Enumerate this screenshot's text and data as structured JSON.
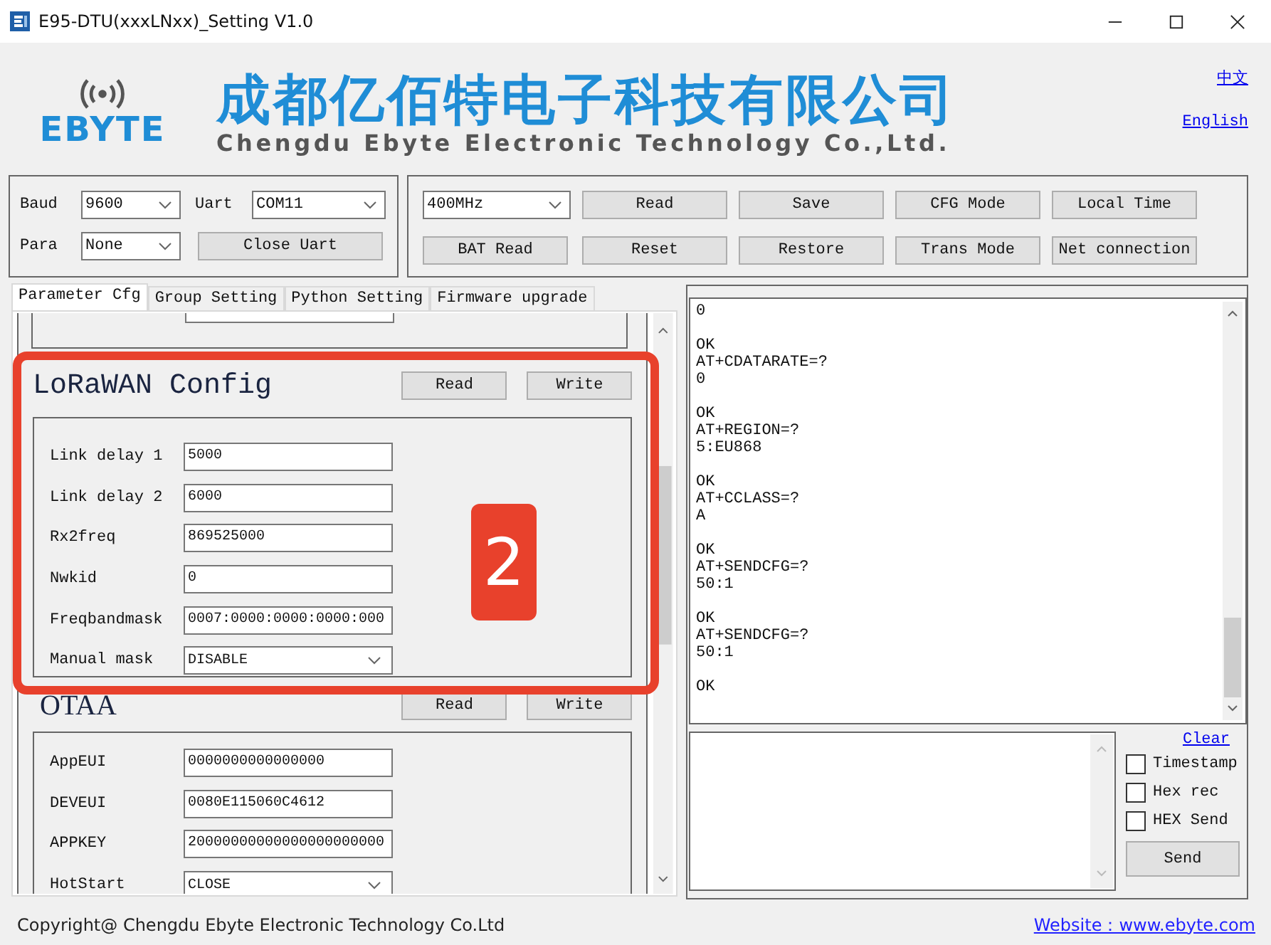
{
  "window": {
    "title": "E95-DTU(xxxLNxx)_Setting V1.0"
  },
  "header": {
    "logo_text": "EBYTE",
    "company_cn": "成都亿佰特电子科技有限公司",
    "company_en": "Chengdu Ebyte Electronic Technology Co.,Ltd.",
    "links": [
      "中文",
      "English"
    ]
  },
  "serial": {
    "fields": [
      {
        "label": "Baud",
        "value": "9600"
      },
      {
        "label": "Uart",
        "value": "COM11"
      },
      {
        "label": "Para",
        "value": "None"
      }
    ],
    "button": "Close Uart"
  },
  "device": {
    "band": "400MHz",
    "button_rows": [
      [
        "Read",
        "Save",
        "CFG Mode",
        "Local Time"
      ],
      [
        "BAT Read",
        "Reset",
        "Restore",
        "Trans Mode",
        "Net connection"
      ]
    ]
  },
  "tabs": [
    {
      "label": "Parameter Cfg",
      "selected": true
    },
    {
      "label": "Group Setting",
      "selected": false
    },
    {
      "label": "Python Setting",
      "selected": false
    },
    {
      "label": "Firmware upgrade",
      "selected": false
    }
  ],
  "sections": [
    {
      "title": "LoRaWAN Config",
      "buttons": [
        "Read",
        "Write"
      ],
      "fields": [
        {
          "kind": "input",
          "label": "Link delay 1",
          "value": "5000"
        },
        {
          "kind": "input",
          "label": "Link delay 2",
          "value": "6000"
        },
        {
          "kind": "input",
          "label": "Rx2freq",
          "value": "869525000"
        },
        {
          "kind": "input",
          "label": "Nwkid",
          "value": "0"
        },
        {
          "kind": "input",
          "label": "Freqbandmask",
          "value": "0007:0000:0000:0000:000"
        },
        {
          "kind": "select",
          "label": "Manual mask",
          "value": "DISABLE"
        }
      ]
    },
    {
      "title": "OTAA",
      "buttons": [
        "Read",
        "Write"
      ],
      "fields": [
        {
          "kind": "input",
          "label": "AppEUI",
          "value": "0000000000000000"
        },
        {
          "kind": "input",
          "label": "DEVEUI",
          "value": "0080E115060C4612"
        },
        {
          "kind": "input",
          "label": "APPKEY",
          "value": "20000000000000000000000"
        },
        {
          "kind": "select",
          "label": "HotStart",
          "value": "CLOSE"
        }
      ]
    }
  ],
  "annotation": {
    "number": "2"
  },
  "log": {
    "blocks": [
      [
        "0"
      ],
      [
        "OK",
        "AT+CDATARATE=?",
        "0"
      ],
      [
        "OK",
        "AT+REGION=?",
        "5:EU868"
      ],
      [
        "OK",
        "AT+CCLASS=?",
        "A"
      ],
      [
        "OK",
        "AT+SENDCFG=?",
        "50:1"
      ],
      [
        "OK",
        "AT+SENDCFG=?",
        "50:1"
      ],
      [
        "OK"
      ]
    ]
  },
  "send": {
    "clear_link": "Clear",
    "options": [
      {
        "label": "Timestamp",
        "checked": false
      },
      {
        "label": "Hex rec",
        "checked": false
      },
      {
        "label": "HEX Send",
        "checked": false
      }
    ],
    "button": "Send"
  },
  "footer": {
    "copyright": "Copyright@ Chengdu Ebyte Electronic Technology Co.Ltd",
    "website": "Website：www.ebyte.com"
  }
}
